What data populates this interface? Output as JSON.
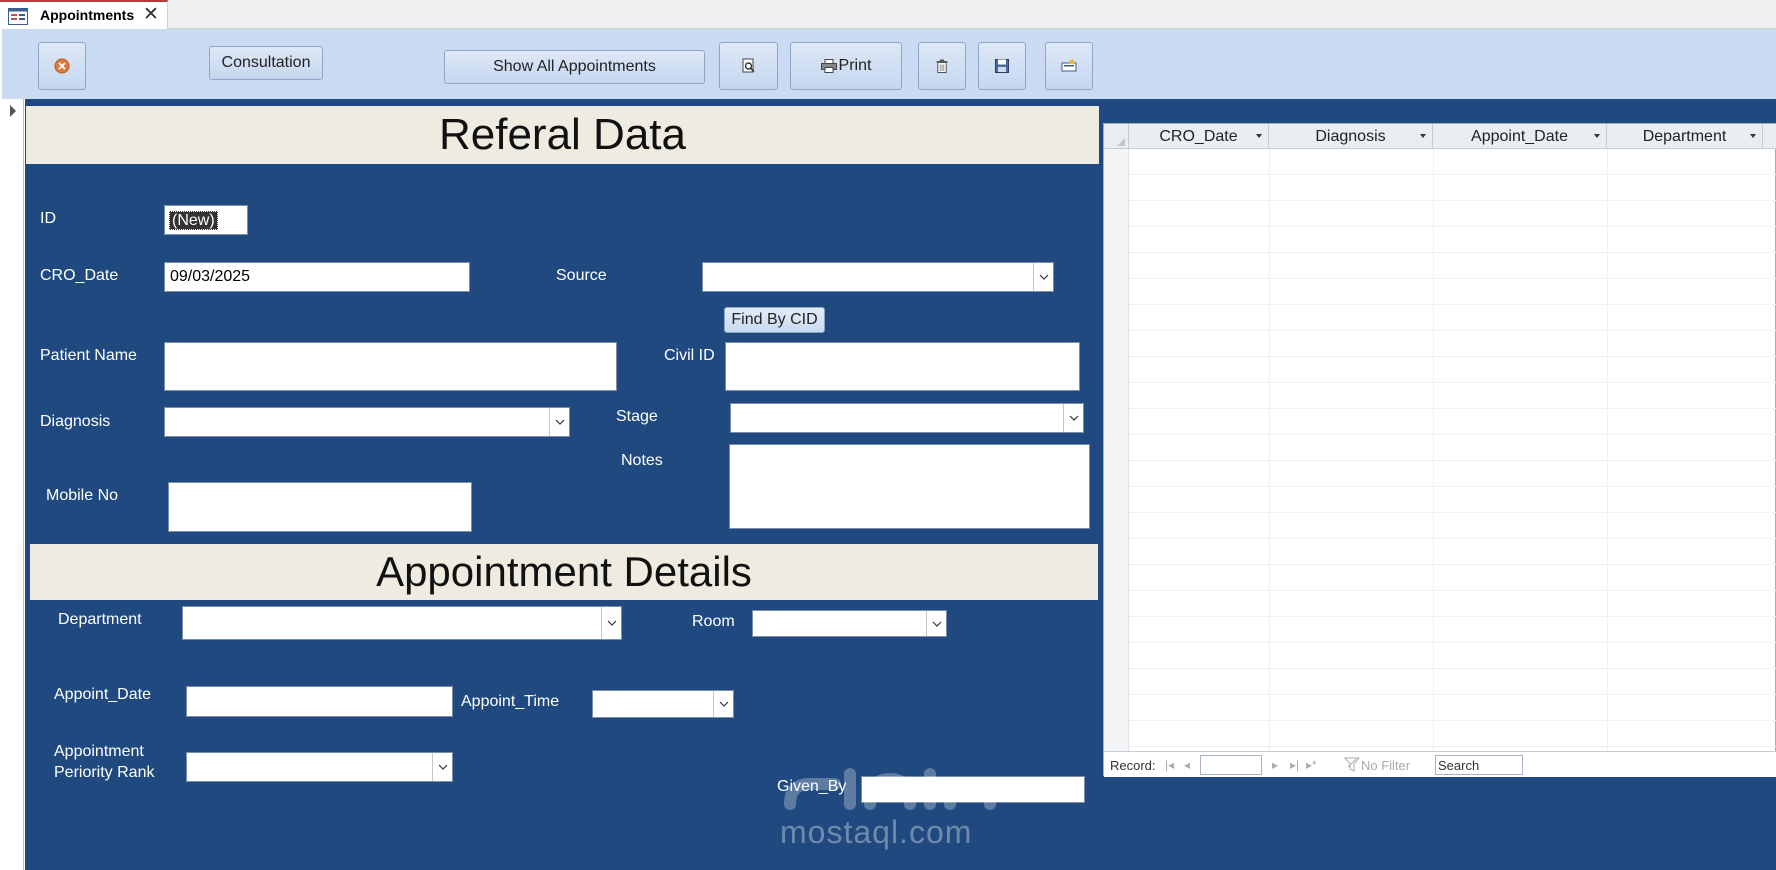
{
  "tab": {
    "title": "Appointments",
    "close": "✕"
  },
  "toolbar": {
    "consultation_label": "Consultation",
    "show_all_label": "Show All Appointments",
    "print_label": "Print"
  },
  "referral": {
    "header": "Referal Data",
    "id_label": "ID",
    "id_value": "(New)",
    "cro_date_label": "CRO_Date",
    "cro_date_value": "09/03/2025",
    "source_label": "Source",
    "find_by_cid_label": "Find By CID",
    "patient_name_label": "Patient Name",
    "civil_id_label": "Civil ID",
    "diagnosis_label": "Diagnosis",
    "stage_label": "Stage",
    "notes_label": "Notes",
    "mobile_label": "Mobile No"
  },
  "appointment": {
    "header": "Appointment Details",
    "department_label": "Department",
    "room_label": "Room",
    "date_label": "Appoint_Date",
    "time_label": "Appoint_Time",
    "rank_label_1": "Appointment",
    "rank_label_2": "Periority Rank",
    "given_by_label": "Given_By"
  },
  "datasheet": {
    "columns": [
      "CRO_Date",
      "Diagnosis",
      "Appoint_Date",
      "Department"
    ],
    "nav": {
      "record_label": "Record:",
      "no_filter": "No Filter",
      "search": "Search"
    }
  },
  "watermark": {
    "text": "mostaql.com"
  },
  "colors": {
    "form_bg": "#204a7f",
    "toolbar_bg": "#c9daf2",
    "header_band": "#eeebe1",
    "tab_accent": "#b83b3b"
  }
}
